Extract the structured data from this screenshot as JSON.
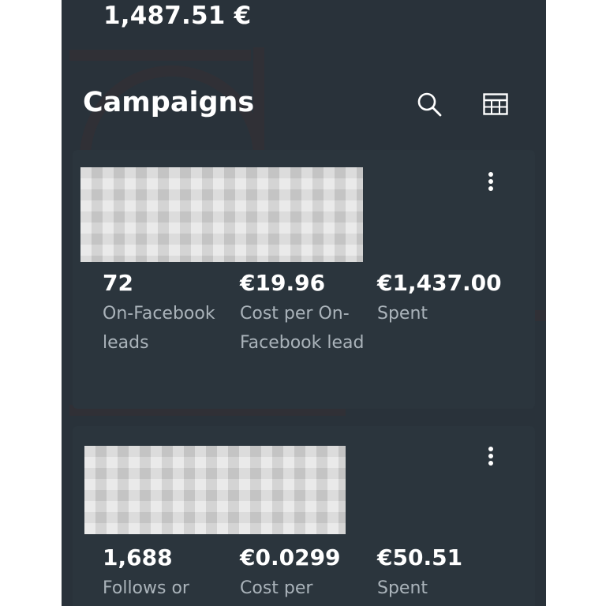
{
  "summary": {
    "total_spent": "1,487.51 €"
  },
  "campaigns_section": {
    "title": "Campaigns",
    "search_icon": "search-icon",
    "table_icon": "table-grid-icon"
  },
  "campaigns": [
    {
      "name_redacted": true,
      "metrics": [
        {
          "value": "72",
          "label": "On-Facebook leads"
        },
        {
          "value": "€19.96",
          "label": "Cost per On-Facebook lead"
        },
        {
          "value": "€1,437.00",
          "label": "Spent"
        }
      ]
    },
    {
      "name_redacted": true,
      "metrics": [
        {
          "value": "1,688",
          "label": "Follows or"
        },
        {
          "value": "€0.0299",
          "label": "Cost per"
        },
        {
          "value": "€50.51",
          "label": "Spent"
        }
      ]
    }
  ],
  "colors": {
    "background": "#29323a",
    "card": "#2b353d",
    "text_primary": "#ffffff",
    "text_secondary": "#aab3ba"
  }
}
